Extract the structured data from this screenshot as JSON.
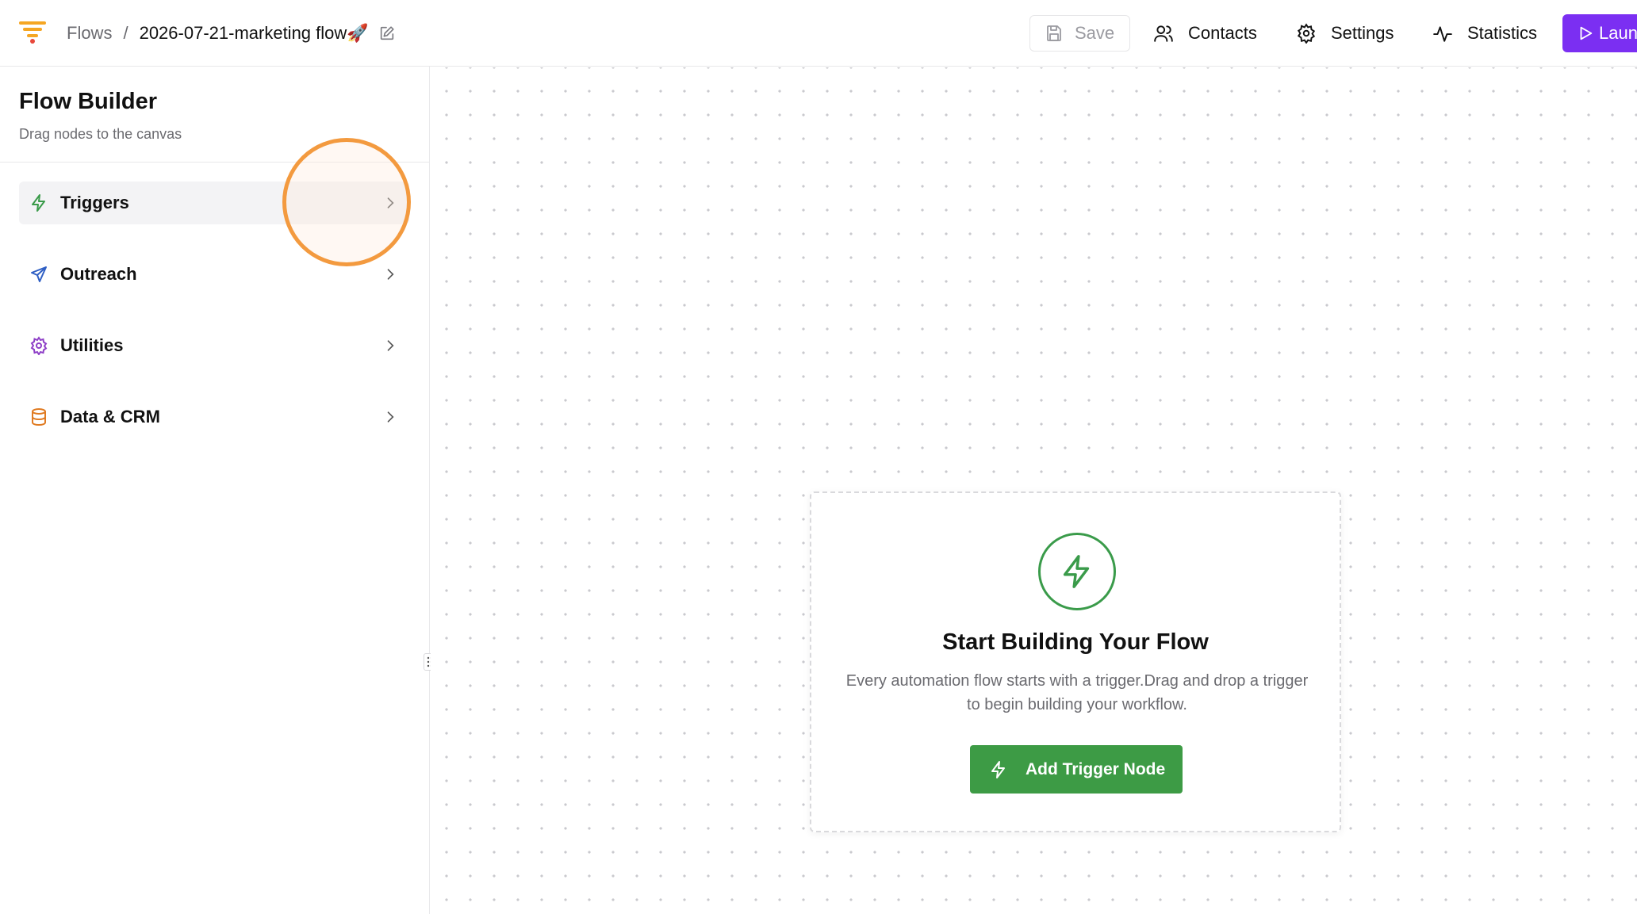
{
  "header": {
    "breadcrumb_root": "Flows",
    "breadcrumb_separator": "/",
    "flow_name": "2026-07-21-marketing flow🚀",
    "save_label": "Save",
    "contacts_label": "Contacts",
    "settings_label": "Settings",
    "statistics_label": "Statistics",
    "launch_label": "Launch"
  },
  "sidebar": {
    "title": "Flow Builder",
    "subtitle": "Drag nodes to the canvas",
    "categories": [
      {
        "label": "Triggers",
        "icon": "lightning-icon",
        "color": "#3a9b4a",
        "active": true
      },
      {
        "label": "Outreach",
        "icon": "send-icon",
        "color": "#2f5fc4",
        "active": false
      },
      {
        "label": "Utilities",
        "icon": "gear-icon",
        "color": "#8e3fc7",
        "active": false
      },
      {
        "label": "Data & CRM",
        "icon": "database-icon",
        "color": "#e07b22",
        "active": false
      }
    ]
  },
  "canvas": {
    "card_title": "Start Building Your Flow",
    "card_description": "Every automation flow starts with a trigger.Drag and drop a trigger to begin building your workflow.",
    "add_button_label": "Add Trigger Node"
  },
  "colors": {
    "accent_purple": "#7b2ff2",
    "trigger_green": "#3d9b45",
    "highlight_orange": "#f39a3f"
  }
}
